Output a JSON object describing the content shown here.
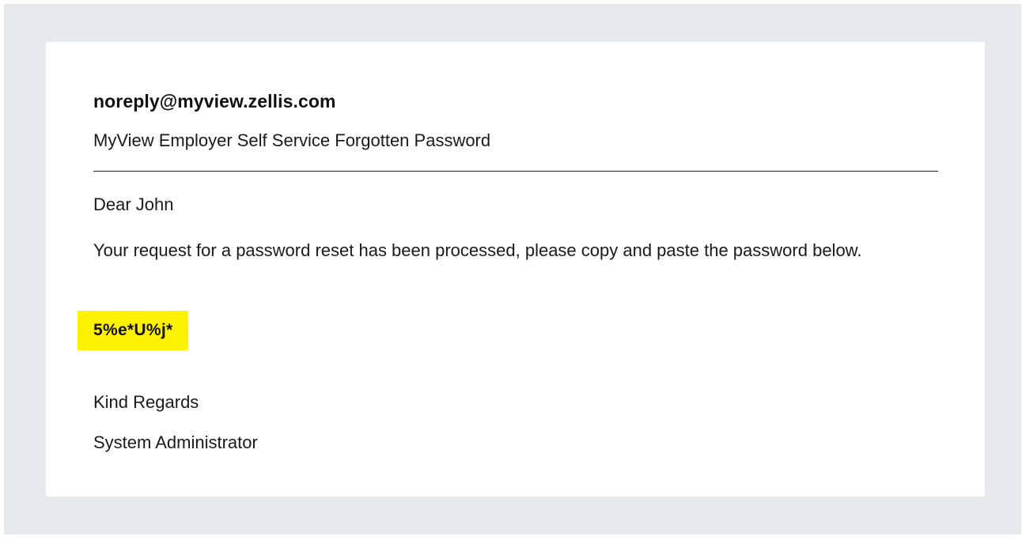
{
  "email": {
    "sender": "noreply@myview.zellis.com",
    "subject": "MyView Employer Self Service Forgotten Password",
    "greeting": "Dear John",
    "body": "Your request for a password reset has been processed, please copy and paste the password below.",
    "password": "5%e*U%j*",
    "signoff": "Kind Regards",
    "signature": "System Administrator"
  },
  "colors": {
    "background": "#e6e9ec",
    "card": "#ffffff",
    "highlight": "#fff200",
    "text": "#1a1a1a"
  }
}
